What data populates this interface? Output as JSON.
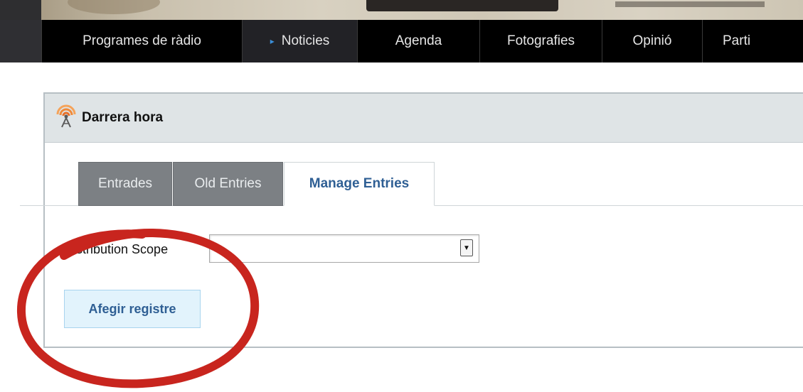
{
  "nav": {
    "items": [
      {
        "label": "Programes de ràdio",
        "active": false
      },
      {
        "label": "Noticies",
        "active": true
      },
      {
        "label": "Agenda",
        "active": false
      },
      {
        "label": "Fotografies",
        "active": false
      },
      {
        "label": "Opinió",
        "active": false
      },
      {
        "label": "Parti",
        "active": false
      }
    ],
    "active_marker": "▸"
  },
  "portlet": {
    "title": "Darrera hora",
    "icon": "radio-broadcast-icon",
    "tabs": [
      {
        "label": "Entrades",
        "active": false
      },
      {
        "label": "Old Entries",
        "active": false
      },
      {
        "label": "Manage Entries",
        "active": true
      }
    ],
    "scope_label": "Distribution Scope",
    "scope_value": "",
    "add_button": "Afegir registre"
  },
  "colors": {
    "nav_bg": "#000000",
    "active_arrow": "#3b8fd9",
    "tab_inactive": "#7c8084",
    "tab_active_text": "#2f5f94",
    "button_bg": "#e2f3fc",
    "annotation": "#c8251e"
  }
}
